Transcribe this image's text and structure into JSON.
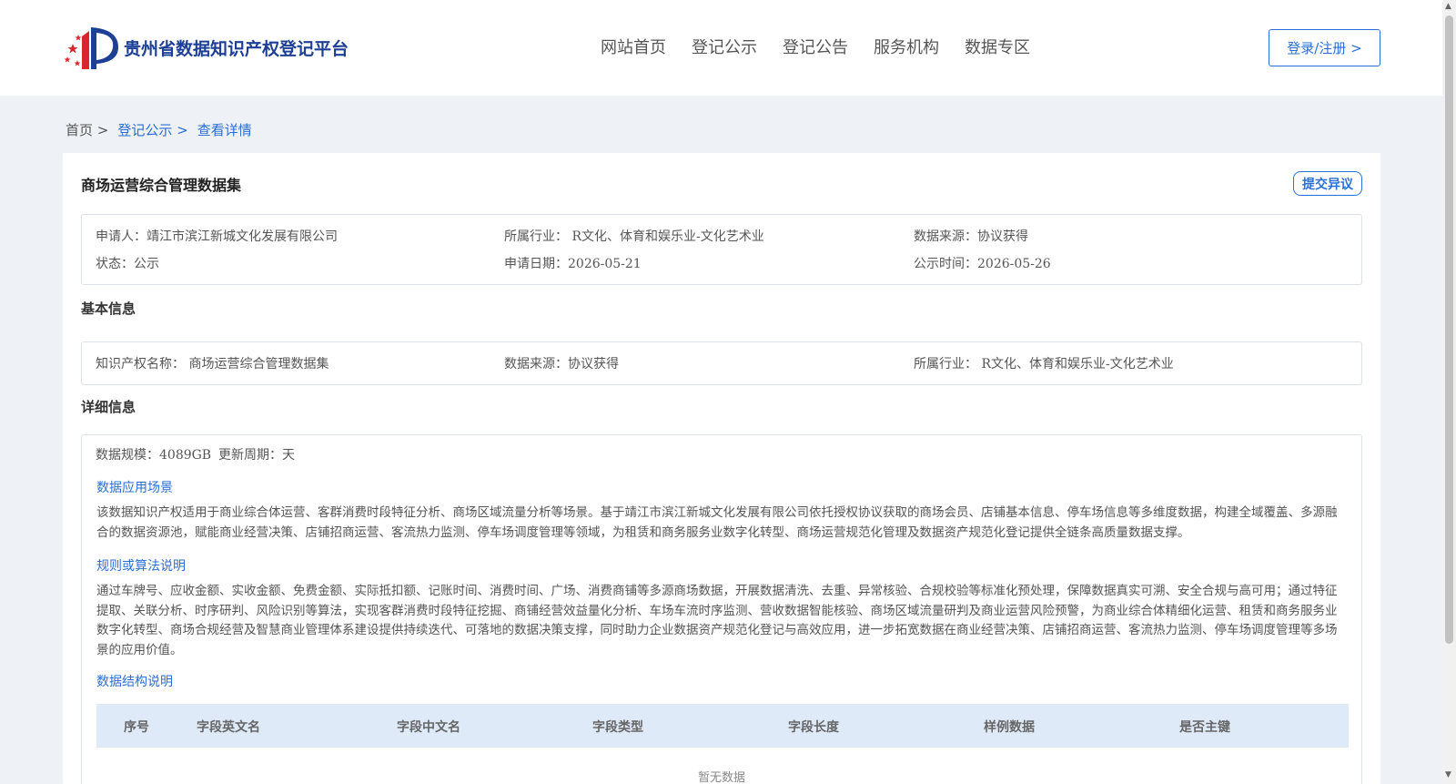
{
  "header": {
    "logo_text": "贵州省数据知识产权登记平台",
    "nav": [
      "网站首页",
      "登记公示",
      "登记公告",
      "服务机构",
      "数据专区"
    ],
    "login_label": "登录/注册 >"
  },
  "breadcrumb": {
    "home": "首页 >",
    "registry": "登记公示 >",
    "current": "查看详情"
  },
  "detail": {
    "title": "商场运营综合管理数据集",
    "objection_label": "提交异议",
    "summary": {
      "applicant": "申请人：靖江市滨江新城文化发展有限公司",
      "industry": "所属行业： R文化、体育和娱乐业-文化艺术业",
      "source": "数据来源：协议获得",
      "status": "状态：公示",
      "apply_date": "申请日期：2026-05-21",
      "publish_date": "公示时间：2026-05-26"
    },
    "basic_heading": "基本信息",
    "basic": {
      "ip_name": "知识产权名称： 商场运营综合管理数据集",
      "source": "数据来源：协议获得",
      "industry": "所属行业： R文化、体育和娱乐业-文化艺术业"
    },
    "detail_heading": "详细信息",
    "scale": "数据规模：4089GB",
    "cycle": "更新周期：天",
    "scenario_heading": "数据应用场景",
    "scenario_text": "该数据知识产权适用于商业综合体运营、客群消费时段特征分析、商场区域流量分析等场景。基于靖江市滨江新城文化发展有限公司依托授权协议获取的商场会员、店铺基本信息、停车场信息等多维度数据，构建全域覆盖、多源融合的数据资源池，赋能商业经营决策、店铺招商运营、客流热力监测、停车场调度管理等领域，为租赁和商务服务业数字化转型、商场运营规范化管理及数据资产规范化登记提供全链条高质量数据支撑。",
    "rules_heading": "规则或算法说明",
    "rules_text": "通过车牌号、应收金额、实收金额、免费金额、实际抵扣额、记账时间、消费时间、广场、消费商铺等多源商场数据，开展数据清洗、去重、异常核验、合规校验等标准化预处理，保障数据真实可溯、安全合规与高可用；通过特征提取、关联分析、时序研判、风险识别等算法，实现客群消费时段特征挖掘、商铺经营效益量化分析、车场车流时序监测、营收数据智能核验、商场区域流量研判及商业运营风险预警，为商业综合体精细化运营、租赁和商务服务业数字化转型、商场合规经营及智慧商业管理体系建设提供持续迭代、可落地的数据决策支撑，同时助力企业数据资产规范化登记与高效应用，进一步拓宽数据在商业经营决策、店铺招商运营、客流热力监测、停车场调度管理等多场景的应用价值。",
    "structure_heading": "数据结构说明",
    "table_headers": [
      "序号",
      "字段英文名",
      "字段中文名",
      "字段类型",
      "字段长度",
      "样例数据",
      "是否主键"
    ],
    "empty_text": "暂无数据"
  }
}
